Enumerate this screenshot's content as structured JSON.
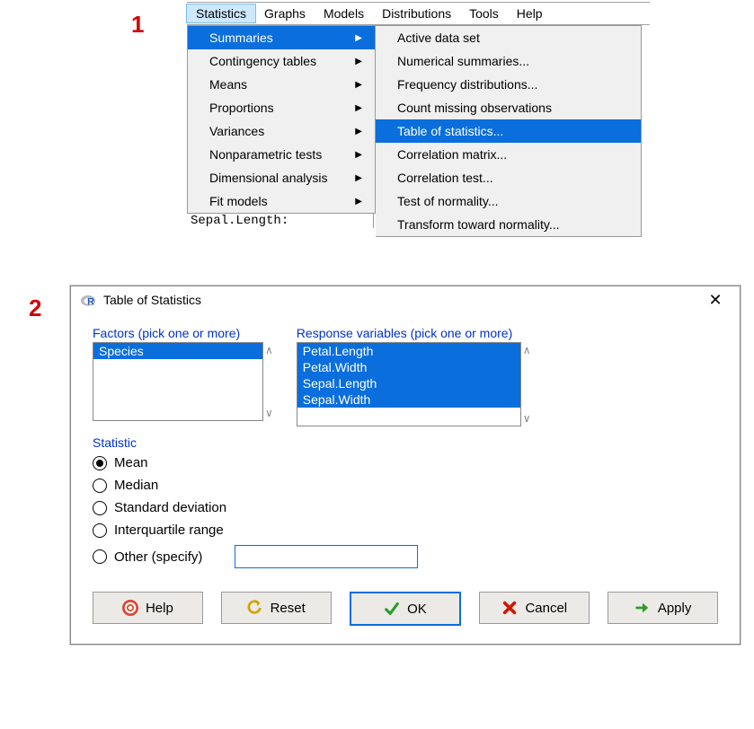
{
  "annotations": {
    "one": "1",
    "two": "2"
  },
  "menubar": {
    "items": [
      "Statistics",
      "Graphs",
      "Models",
      "Distributions",
      "Tools",
      "Help"
    ],
    "active": 0
  },
  "dropdown1": [
    {
      "label": "Summaries",
      "arrow": true,
      "highlight": true
    },
    {
      "label": "Contingency tables",
      "arrow": true
    },
    {
      "label": "Means",
      "arrow": true
    },
    {
      "label": "Proportions",
      "arrow": true
    },
    {
      "label": "Variances",
      "arrow": true
    },
    {
      "label": "Nonparametric tests",
      "arrow": true
    },
    {
      "label": "Dimensional analysis",
      "arrow": true
    },
    {
      "label": "Fit models",
      "arrow": true
    }
  ],
  "dropdown2": [
    {
      "label": "Active data set"
    },
    {
      "label": "Numerical summaries..."
    },
    {
      "label": "Frequency distributions..."
    },
    {
      "label": "Count missing observations"
    },
    {
      "label": "Table of statistics...",
      "highlight": true
    },
    {
      "label": "Correlation matrix..."
    },
    {
      "label": "Correlation test..."
    },
    {
      "label": "Test of normality..."
    },
    {
      "label": "Transform toward normality..."
    }
  ],
  "console_peek": "Sepal.Length:",
  "dialog": {
    "title": "Table of Statistics",
    "factors_label": "Factors (pick one or more)",
    "response_label": "Response variables (pick one or more)",
    "factors": [
      "Species"
    ],
    "responses": [
      "Petal.Length",
      "Petal.Width",
      "Sepal.Length",
      "Sepal.Width"
    ],
    "statistic_label": "Statistic",
    "radios": [
      {
        "label": "Mean",
        "checked": true
      },
      {
        "label": "Median"
      },
      {
        "label": "Standard deviation"
      },
      {
        "label": "Interquartile range"
      },
      {
        "label": "Other (specify)",
        "has_input": true
      }
    ],
    "other_value": "",
    "buttons": {
      "help": "Help",
      "reset": "Reset",
      "ok": "OK",
      "cancel": "Cancel",
      "apply": "Apply"
    }
  }
}
